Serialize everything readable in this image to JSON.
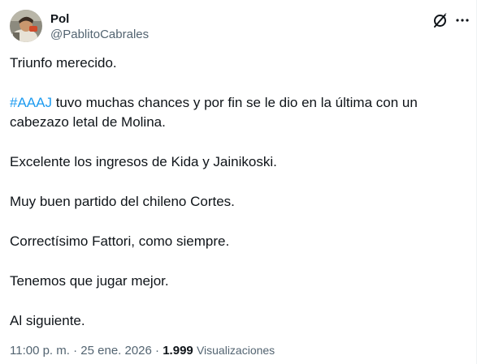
{
  "author": {
    "display_name": "Pol",
    "handle": "@PablitoCabrales"
  },
  "icons": {
    "grok": "grok-icon",
    "more": "more-dots-icon"
  },
  "body": {
    "p1": "Triunfo merecido.",
    "p2_hashtag": "#AAAJ",
    "p2_rest": " tuvo muchas chances y por fin se le dio en la última con un cabezazo letal de Molina.",
    "p3": "Excelente los ingresos de Kida y Jainikoski.",
    "p4": "Muy buen partido del chileno Cortes.",
    "p5": "Correctísimo Fattori, como siempre.",
    "p6": "Tenemos que jugar mejor.",
    "p7": "Al siguiente."
  },
  "meta": {
    "time": "11:00 p. m.",
    "separator": "·",
    "date": "25 ene. 2026",
    "views_count": "1.999",
    "views_label": "Visualizaciones"
  },
  "colors": {
    "text": "#0f1419",
    "secondary": "#536471",
    "link": "#1d9bf0"
  }
}
